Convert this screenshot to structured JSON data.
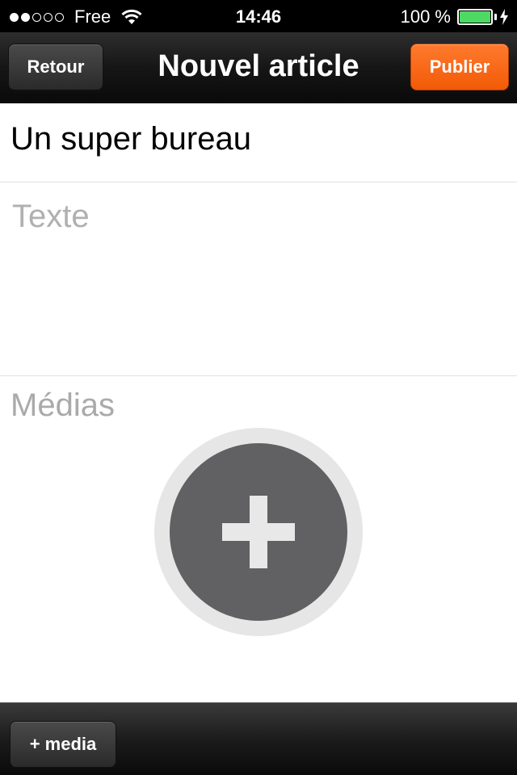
{
  "status_bar": {
    "signal_dots_filled": 2,
    "signal_dots_total": 5,
    "carrier": "Free",
    "time": "14:46",
    "battery_percent": "100 %",
    "battery_level": 1.0,
    "icons": [
      "wifi-icon",
      "battery-icon",
      "charging-bolt-icon"
    ]
  },
  "nav": {
    "title": "Nouvel article",
    "back_label": "Retour",
    "publish_label": "Publier"
  },
  "form": {
    "title_value": "Un super bureau",
    "text_placeholder": "Texte",
    "media_label": "Médias",
    "add_media_icon": "plus-icon"
  },
  "toolbar": {
    "media_button_label": "+ media"
  },
  "colors": {
    "accent_orange": "#f25a06",
    "dark_bar": "#161616",
    "placeholder_gray": "#b0b0b0",
    "add_circle": "#616163"
  }
}
